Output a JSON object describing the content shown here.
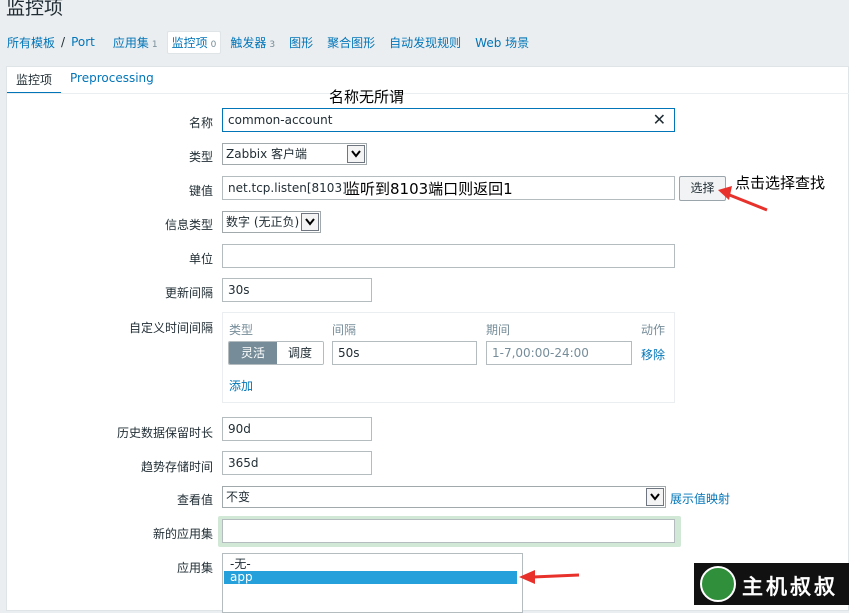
{
  "page": {
    "title": "监控项"
  },
  "nav": {
    "breadcrumbs": [
      {
        "label": "所有模板"
      },
      {
        "label": "Port"
      }
    ],
    "tabs": [
      {
        "label": "应用集",
        "count": "1"
      },
      {
        "label": "监控项",
        "count": "0",
        "active": true
      },
      {
        "label": "触发器",
        "count": "3"
      },
      {
        "label": "图形",
        "count": ""
      },
      {
        "label": "聚合图形",
        "count": ""
      },
      {
        "label": "自动发现规则",
        "count": ""
      },
      {
        "label": "Web 场景",
        "count": ""
      }
    ]
  },
  "form_tabs": [
    {
      "label": "监控项",
      "active": true
    },
    {
      "label": "Preprocessing",
      "active": false
    }
  ],
  "form": {
    "name": {
      "label": "名称",
      "value": "common-account",
      "clear_icon": "close-icon"
    },
    "type": {
      "label": "类型",
      "value": "Zabbix 客户端"
    },
    "key": {
      "label": "键值",
      "value": "net.tcp.listen[8103]",
      "button": "选择"
    },
    "info_type": {
      "label": "信息类型",
      "value": "数字 (无正负)"
    },
    "units": {
      "label": "单位",
      "value": ""
    },
    "update_interval": {
      "label": "更新间隔",
      "value": "30s"
    },
    "custom_intervals": {
      "label": "自定义时间间隔",
      "col_type": "类型",
      "col_interval": "间隔",
      "col_period": "期间",
      "col_action": "动作",
      "mode_flexible": "灵活",
      "mode_scheduling": "调度",
      "interval_value": "50s",
      "period_value": "1-7,00:00-24:00",
      "remove": "移除",
      "add": "添加"
    },
    "history": {
      "label": "历史数据保留时长",
      "value": "90d"
    },
    "trends": {
      "label": "趋势存储时间",
      "value": "365d"
    },
    "show_value": {
      "label": "查看值",
      "value": "不变",
      "link": "展示值映射"
    },
    "new_application": {
      "label": "新的应用集",
      "value": ""
    },
    "applications": {
      "label": "应用集",
      "options": [
        "-无-",
        "app"
      ],
      "selected": "app"
    }
  },
  "annotations": {
    "name_note": "名称无所谓",
    "key_note": "监听到8103端口则返回1",
    "select_note": "点击选择查找"
  },
  "logo": {
    "text": "主机叔叔"
  },
  "colors": {
    "link": "#0275b8",
    "annotation_arrow": "#e8312b",
    "selected_option": "#26a0da",
    "segment_active": "#768d99"
  }
}
